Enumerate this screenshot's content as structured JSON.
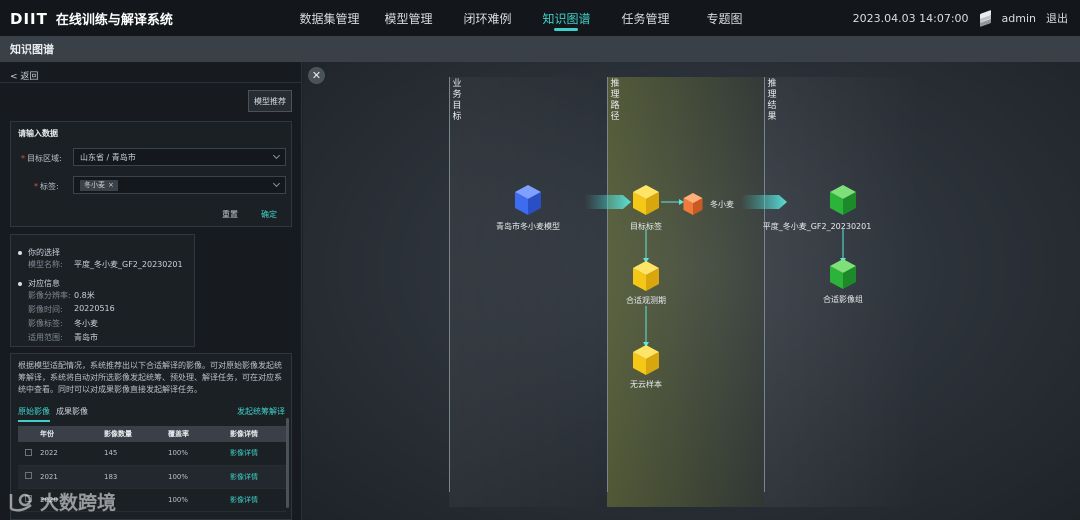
{
  "app": {
    "logo": "DIIT",
    "title": "在线训练与解译系统"
  },
  "nav": [
    {
      "label": "数据集管理",
      "active": false
    },
    {
      "label": "模型管理",
      "active": false
    },
    {
      "label": "闭环难例",
      "active": false
    },
    {
      "label": "知识图谱",
      "active": true
    },
    {
      "label": "任务管理",
      "active": false
    },
    {
      "label": "专题图",
      "active": false
    }
  ],
  "header": {
    "datetime": "2023.04.03 14:07:00",
    "user": "admin",
    "logout": "退出"
  },
  "page": {
    "title": "知识图谱"
  },
  "left": {
    "back": "< 返回",
    "recommend_button": "模型推荐",
    "input_title": "请输入数据",
    "region_label": "目标区域:",
    "region_value": "山东省 / 青岛市",
    "tags_label": "标签:",
    "tag_value": "冬小麦",
    "reset": "重置",
    "confirm": "确定",
    "choice_head": "你的选择",
    "model_name_label": "模型名称:",
    "model_name_value": "平度_冬小麦_GF2_20230201",
    "match_head": "对应信息",
    "info": [
      {
        "k": "影像分辨率:",
        "v": "0.8米"
      },
      {
        "k": "影像时间:",
        "v": "20220516"
      },
      {
        "k": "影像标签:",
        "v": "冬小麦"
      },
      {
        "k": "适用范围:",
        "v": "青岛市"
      }
    ],
    "description": "根据模型适配情况，系统推荐出以下合适解译的影像。可对原始影像发起统筹解译，系统将自动对所选影像发起统筹、预处理、解译任务，可在对应系统中查看。同时可以对成果影像直接发起解译任务。",
    "tabs": [
      "原始影像",
      "成果影像"
    ],
    "batch_link": "发起统筹解译",
    "table": {
      "headers": [
        "",
        "年份",
        "影像数量",
        "覆盖率",
        "影像详情"
      ],
      "rows": [
        {
          "year": "2022",
          "count": "145",
          "coverage": "100%",
          "detail": "影像详情"
        },
        {
          "year": "2021",
          "count": "183",
          "coverage": "100%",
          "detail": "影像详情"
        },
        {
          "year": "2020",
          "count": "",
          "coverage": "100%",
          "detail": "影像详情"
        }
      ]
    }
  },
  "graph": {
    "columns": [
      "业务目标",
      "推理路径",
      "推理结果"
    ],
    "nodes": {
      "model": "青岛市冬小麦模型",
      "target": "目标标签",
      "crop": "冬小麦",
      "phase": "合适观测期",
      "cloud": "无云样本",
      "result": "平度_冬小麦_GF2_20230201",
      "group": "合适影像组"
    },
    "colors": {
      "accent": "#3fd0c9",
      "blue": "#3d6cf0",
      "yellow": "#f5c818",
      "orange": "#f07a3a",
      "green": "#2cb43a"
    }
  },
  "watermark": "大数跨境"
}
